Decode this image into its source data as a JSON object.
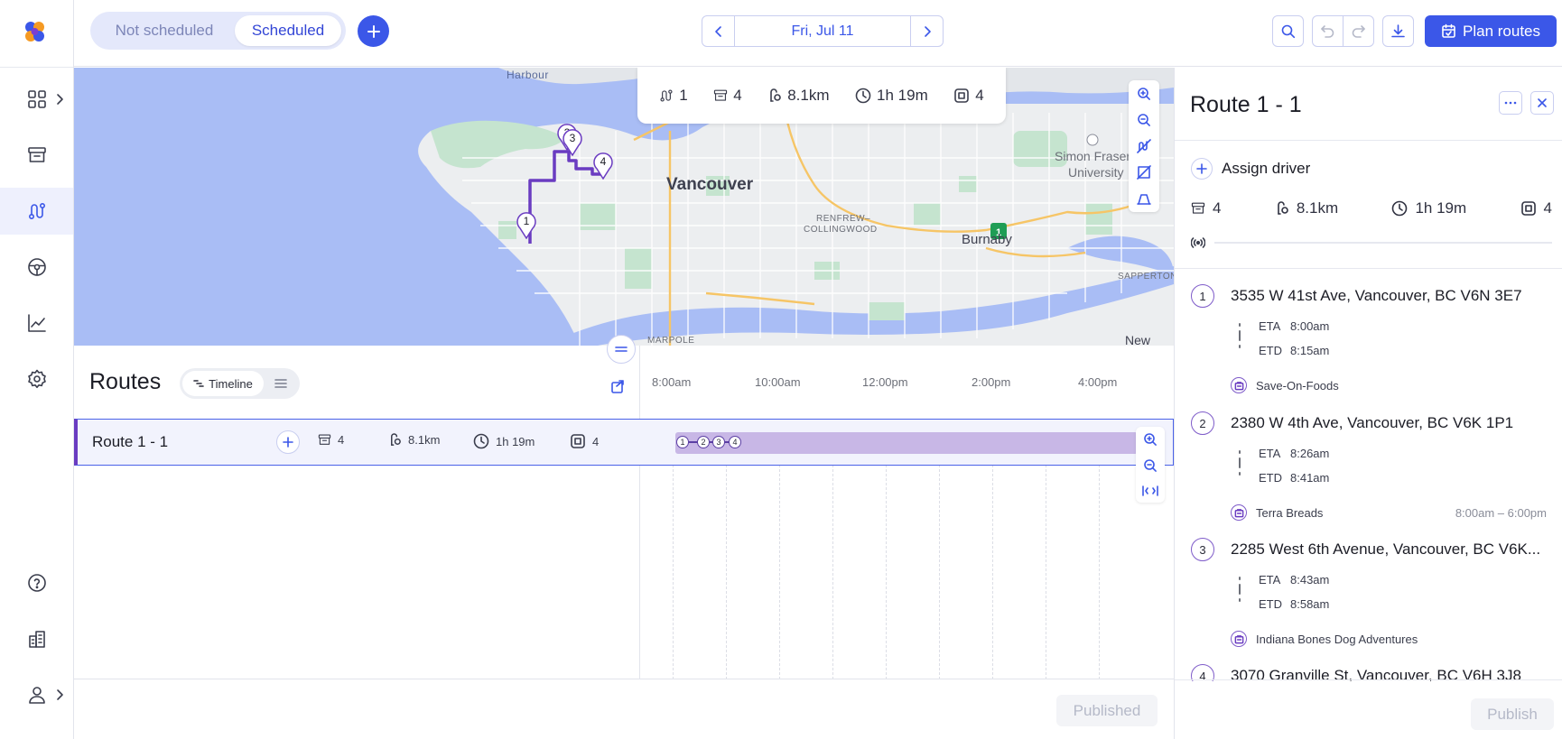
{
  "nav": {
    "items": [
      {
        "name": "dashboard-icon"
      },
      {
        "name": "orders-icon"
      },
      {
        "name": "routes-icon"
      },
      {
        "name": "drivers-icon"
      },
      {
        "name": "analytics-icon"
      },
      {
        "name": "settings-icon"
      },
      {
        "name": "help-icon"
      },
      {
        "name": "company-icon"
      },
      {
        "name": "user-icon"
      }
    ]
  },
  "topbar": {
    "toggle_off": "Not scheduled",
    "toggle_on": "Scheduled",
    "date": "Fri, Jul 11",
    "plan_label": "Plan routes"
  },
  "map": {
    "summary": {
      "routes": "1",
      "orders": "4",
      "distance": "8.1km",
      "duration": "1h 19m",
      "stops": "4"
    },
    "labels": {
      "harbour": "Harbour",
      "vancouver": "Vancouver",
      "renfrew": "RENFREW–",
      "collingwood": "COLLINGWOOD",
      "burnaby": "Burnaby",
      "sfu1": "Simon Fraser",
      "sfu2": "University",
      "sapperton": "SAPPERTON",
      "marpole": "MARPOLE",
      "new": "New",
      "highway": "1"
    },
    "pins": [
      "1",
      "2",
      "3",
      "4"
    ],
    "colors": {
      "water": "#a9bdf5",
      "land": "#eceef0",
      "park": "#c5e4cf",
      "route": "#6a3cc1",
      "arterial": "#f6c566"
    }
  },
  "routes": {
    "title": "Routes",
    "view_timeline": "Timeline",
    "ticks": [
      "8:00am",
      "10:00am",
      "12:00pm",
      "2:00pm",
      "4:00pm"
    ],
    "row": {
      "name": "Route 1 - 1",
      "orders": "4",
      "distance": "8.1km",
      "duration": "1h 19m",
      "stops": "4",
      "stop_labels": [
        "1",
        "2",
        "3",
        "4"
      ]
    },
    "published_label": "Published"
  },
  "panel": {
    "title": "Route 1 - 1",
    "assign_label": "Assign driver",
    "stats": {
      "orders": "4",
      "distance": "8.1km",
      "duration": "1h 19m",
      "stops": "4"
    },
    "stops": [
      {
        "num": "1",
        "address": "3535 W 41st Ave, Vancouver, BC V6N 3E7",
        "eta_label": "ETA",
        "eta": "8:00am",
        "etd_label": "ETD",
        "etd": "8:15am",
        "place": "Save-On-Foods",
        "window": ""
      },
      {
        "num": "2",
        "address": "2380 W 4th Ave, Vancouver, BC V6K 1P1",
        "eta_label": "ETA",
        "eta": "8:26am",
        "etd_label": "ETD",
        "etd": "8:41am",
        "place": "Terra Breads",
        "window": "8:00am – 6:00pm"
      },
      {
        "num": "3",
        "address": "2285 West 6th Avenue, Vancouver, BC V6K...",
        "eta_label": "ETA",
        "eta": "8:43am",
        "etd_label": "ETD",
        "etd": "8:58am",
        "place": "Indiana Bones Dog Adventures",
        "window": ""
      },
      {
        "num": "4",
        "address": "3070 Granville St, Vancouver, BC V6H 3J8",
        "eta_label": "",
        "eta": "",
        "etd_label": "",
        "etd": "",
        "place": "",
        "window": ""
      }
    ],
    "publish_label": "Publish"
  },
  "colors": {
    "accent": "#3b57e8",
    "route": "#6a3cc1",
    "timeline_bar": "#c8b7e6"
  }
}
